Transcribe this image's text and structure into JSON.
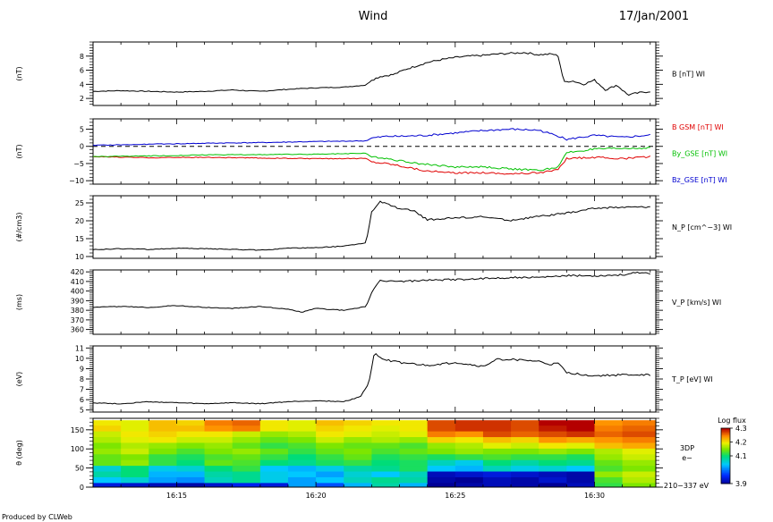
{
  "header": {
    "title": "Wind",
    "date": "17/Jan/2001"
  },
  "footer": {
    "credit": "Produced by CLWeb"
  },
  "x_axis": {
    "start_min": 12.0,
    "end_min": 32.2,
    "ticks": [
      {
        "value": 15,
        "label": "16:15"
      },
      {
        "value": 20,
        "label": "16:20"
      },
      {
        "value": 25,
        "label": "16:25"
      },
      {
        "value": 30,
        "label": "16:30"
      }
    ]
  },
  "chart_data": [
    {
      "type": "line",
      "ylabel": "(nT)",
      "ylim": [
        1,
        10
      ],
      "yticks": [
        "2",
        "4",
        "6",
        "8"
      ],
      "ytick_values": [
        2,
        4,
        6,
        8
      ],
      "series": [
        {
          "name": "B [nT] WI",
          "color": "#000000",
          "x": [
            12.0,
            13.0,
            14.0,
            15.0,
            16.0,
            17.0,
            18.0,
            19.0,
            20.0,
            21.0,
            21.8,
            22.0,
            22.3,
            22.8,
            23.2,
            23.6,
            24.0,
            24.5,
            25.0,
            25.5,
            26.0,
            26.5,
            27.0,
            27.5,
            28.0,
            28.5,
            28.7,
            28.9,
            29.2,
            29.6,
            30.0,
            30.4,
            30.8,
            31.2,
            31.6,
            32.0
          ],
          "y": [
            3.0,
            3.1,
            3.0,
            2.9,
            3.0,
            3.2,
            3.0,
            3.3,
            3.5,
            3.6,
            3.9,
            4.6,
            5.1,
            5.4,
            6.1,
            6.6,
            7.1,
            7.5,
            7.8,
            8.0,
            8.1,
            8.3,
            8.4,
            8.5,
            8.2,
            8.3,
            8.0,
            4.3,
            4.5,
            4.0,
            4.6,
            3.2,
            3.9,
            2.5,
            2.8,
            3.0
          ]
        }
      ]
    },
    {
      "type": "line",
      "ylabel": "(nT)",
      "ylim": [
        -11,
        8
      ],
      "yticks": [
        "−10",
        "−5",
        "0",
        "5"
      ],
      "ytick_values": [
        -10,
        -5,
        0,
        5
      ],
      "zero_line": true,
      "series": [
        {
          "name": "B GSM [nT] WI",
          "color": "#e00000",
          "x": [
            12.0,
            14.0,
            16.0,
            18.0,
            20.0,
            21.8,
            22.0,
            22.6,
            23.0,
            24.0,
            25.0,
            26.0,
            27.0,
            28.0,
            28.7,
            29.0,
            30.0,
            31.0,
            32.0
          ],
          "y": [
            -3.0,
            -3.3,
            -3.2,
            -3.4,
            -3.6,
            -3.5,
            -4.5,
            -5.0,
            -5.6,
            -7.2,
            -7.8,
            -7.6,
            -8.0,
            -7.7,
            -6.8,
            -3.5,
            -3.2,
            -3.6,
            -3.0
          ]
        },
        {
          "name": "By_GSE [nT] WI",
          "color": "#00c000",
          "x": [
            12.0,
            14.0,
            16.0,
            18.0,
            20.0,
            21.8,
            22.0,
            22.5,
            23.0,
            24.0,
            25.0,
            26.0,
            27.0,
            28.0,
            28.7,
            29.0,
            30.0,
            31.0,
            32.0
          ],
          "y": [
            -3.0,
            -2.8,
            -2.5,
            -2.4,
            -2.3,
            -2.0,
            -3.0,
            -3.5,
            -4.2,
            -5.3,
            -6.0,
            -6.0,
            -6.6,
            -7.0,
            -6.0,
            -1.8,
            -0.8,
            -0.6,
            -0.5
          ]
        },
        {
          "name": "Bz_GSE [nT] WI",
          "color": "#0000d0",
          "x": [
            12.0,
            14.0,
            16.0,
            18.0,
            20.0,
            21.8,
            22.0,
            22.5,
            23.0,
            24.0,
            25.0,
            26.0,
            27.0,
            28.0,
            28.7,
            29.0,
            30.0,
            31.0,
            32.0
          ],
          "y": [
            0.3,
            0.6,
            0.9,
            1.1,
            1.4,
            1.6,
            2.4,
            2.9,
            2.9,
            3.2,
            3.9,
            4.6,
            5.0,
            4.7,
            3.0,
            2.0,
            3.2,
            2.6,
            3.3
          ]
        }
      ]
    },
    {
      "type": "line",
      "ylabel": "(#/cm3)",
      "ylim": [
        9.5,
        27
      ],
      "yticks": [
        "10",
        "15",
        "20",
        "25"
      ],
      "ytick_values": [
        10,
        15,
        20,
        25
      ],
      "series": [
        {
          "name": "N_P [cm^−3] WI",
          "color": "#000000",
          "x": [
            12.0,
            13.0,
            14.0,
            15.0,
            16.0,
            17.0,
            18.0,
            19.0,
            20.0,
            21.0,
            21.8,
            22.0,
            22.3,
            23.0,
            23.5,
            24.0,
            25.0,
            26.0,
            27.0,
            28.0,
            29.0,
            30.0,
            31.0,
            32.0
          ],
          "y": [
            11.9,
            12.2,
            12.0,
            12.3,
            12.2,
            12.0,
            11.8,
            12.3,
            12.5,
            12.9,
            13.8,
            22.5,
            25.3,
            23.4,
            22.8,
            20.3,
            20.8,
            21.1,
            20.1,
            21.2,
            22.1,
            23.5,
            23.8,
            23.9
          ]
        }
      ]
    },
    {
      "type": "line",
      "ylabel": "(ms)",
      "ylim": [
        355,
        422
      ],
      "yticks": [
        "360",
        "370",
        "380",
        "390",
        "400",
        "410",
        "420"
      ],
      "ytick_values": [
        360,
        370,
        380,
        390,
        400,
        410,
        420
      ],
      "series": [
        {
          "name": "V_P [km/s] WI",
          "color": "#000000",
          "x": [
            12.0,
            13.0,
            14.0,
            15.0,
            16.0,
            17.0,
            18.0,
            19.0,
            19.5,
            20.0,
            21.0,
            21.8,
            22.0,
            22.3,
            23.0,
            24.0,
            25.0,
            26.0,
            27.0,
            28.0,
            29.0,
            30.0,
            31.0,
            31.5,
            32.0
          ],
          "y": [
            383.0,
            384.0,
            383.0,
            385.0,
            383.0,
            382.0,
            384.0,
            381.0,
            378.0,
            382.0,
            380.0,
            384.0,
            398.0,
            411.0,
            410.0,
            411.0,
            412.0,
            413.0,
            414.0,
            414.0,
            416.0,
            416.0,
            417.0,
            419.0,
            418.0
          ]
        }
      ]
    },
    {
      "type": "line",
      "ylabel": "(eV)",
      "ylim": [
        4.8,
        11.2
      ],
      "yticks": [
        "5",
        "6",
        "7",
        "8",
        "9",
        "10",
        "11"
      ],
      "ytick_values": [
        5,
        6,
        7,
        8,
        9,
        10,
        11
      ],
      "series": [
        {
          "name": "T_P [eV] WI",
          "color": "#000000",
          "x": [
            12.0,
            13.0,
            14.0,
            15.0,
            16.0,
            17.0,
            18.0,
            19.0,
            20.0,
            21.0,
            21.6,
            21.9,
            22.1,
            22.4,
            23.0,
            24.0,
            25.0,
            26.0,
            26.5,
            27.0,
            28.0,
            28.4,
            28.7,
            29.0,
            30.0,
            31.0,
            32.0
          ],
          "y": [
            5.7,
            5.6,
            5.8,
            5.7,
            5.6,
            5.7,
            5.6,
            5.8,
            5.9,
            5.8,
            6.3,
            7.6,
            10.6,
            9.9,
            9.6,
            9.3,
            9.6,
            9.2,
            9.9,
            9.9,
            9.7,
            9.4,
            9.5,
            8.6,
            8.3,
            8.4,
            8.4
          ]
        }
      ]
    },
    {
      "type": "heatmap",
      "ylabel": "θ (deg)",
      "ylim": [
        0,
        180
      ],
      "yticks": [
        "0",
        "50",
        "100",
        "150"
      ],
      "ytick_values": [
        0,
        50,
        100,
        150
      ],
      "label_lines": [
        "3DP",
        "e−",
        "210−337 eV"
      ],
      "colorbar": {
        "title": "Log flux",
        "range": [
          3.9,
          4.3
        ],
        "ticks": [
          "4.3",
          "4.2",
          "4.1",
          "3.9"
        ],
        "tick_values": [
          4.3,
          4.2,
          4.1,
          3.9
        ]
      },
      "x_edges": [
        12.0,
        13.0,
        14.0,
        15.0,
        16.0,
        17.0,
        18.0,
        19.0,
        20.0,
        21.0,
        22.0,
        23.0,
        24.0,
        25.0,
        26.0,
        27.0,
        28.0,
        29.0,
        30.0,
        31.0,
        32.2
      ],
      "y_edges": [
        0,
        12,
        27,
        42,
        57,
        72,
        87,
        102,
        117,
        132,
        147,
        162,
        175
      ],
      "values": [
        [
          3.94,
          3.93,
          3.92,
          3.91,
          3.93,
          3.95,
          3.94,
          4.02,
          3.98,
          4.03,
          4.08,
          4.03,
          3.9,
          3.91,
          3.92,
          3.91,
          3.9,
          3.92,
          4.12,
          4.15
        ],
        [
          4.04,
          4.06,
          4.02,
          4.01,
          4.07,
          4.09,
          4.05,
          4.02,
          4.04,
          4.07,
          4.09,
          4.08,
          3.91,
          3.9,
          3.92,
          3.91,
          3.93,
          3.91,
          4.13,
          4.17
        ],
        [
          4.08,
          4.1,
          4.03,
          4.03,
          4.08,
          4.09,
          4.05,
          4.04,
          4.02,
          4.06,
          4.04,
          4.07,
          3.92,
          3.93,
          3.94,
          3.93,
          3.92,
          3.91,
          4.16,
          4.18
        ],
        [
          4.06,
          4.1,
          4.05,
          4.06,
          4.1,
          4.12,
          4.04,
          4.03,
          4.05,
          4.08,
          4.09,
          4.11,
          4.04,
          4.03,
          4.07,
          4.05,
          4.06,
          4.04,
          4.13,
          4.15
        ],
        [
          4.14,
          4.16,
          4.12,
          4.1,
          4.14,
          4.13,
          4.1,
          4.09,
          4.11,
          4.12,
          4.1,
          4.11,
          4.07,
          4.05,
          4.1,
          4.08,
          4.1,
          4.09,
          4.14,
          4.16
        ],
        [
          4.14,
          4.15,
          4.12,
          4.11,
          4.13,
          4.14,
          4.12,
          4.1,
          4.12,
          4.14,
          4.11,
          4.12,
          4.11,
          4.12,
          4.13,
          4.12,
          4.12,
          4.11,
          4.16,
          4.18
        ],
        [
          4.16,
          4.18,
          4.15,
          4.13,
          4.15,
          4.16,
          4.14,
          4.12,
          4.14,
          4.15,
          4.13,
          4.14,
          4.15,
          4.16,
          4.15,
          4.15,
          4.16,
          4.15,
          4.17,
          4.19
        ],
        [
          4.15,
          4.17,
          4.16,
          4.15,
          4.16,
          4.14,
          4.12,
          4.13,
          4.15,
          4.14,
          4.14,
          4.13,
          4.16,
          4.17,
          4.19,
          4.18,
          4.2,
          4.19,
          4.22,
          4.23
        ],
        [
          4.17,
          4.19,
          4.2,
          4.18,
          4.18,
          4.16,
          4.14,
          4.15,
          4.18,
          4.16,
          4.17,
          4.16,
          4.21,
          4.2,
          4.22,
          4.21,
          4.24,
          4.23,
          4.24,
          4.25
        ],
        [
          4.18,
          4.2,
          4.21,
          4.2,
          4.2,
          4.18,
          4.16,
          4.17,
          4.2,
          4.19,
          4.18,
          4.19,
          4.25,
          4.24,
          4.27,
          4.26,
          4.27,
          4.28,
          4.26,
          4.27
        ],
        [
          4.21,
          4.19,
          4.22,
          4.22,
          4.24,
          4.25,
          4.2,
          4.19,
          4.21,
          4.2,
          4.19,
          4.2,
          4.27,
          4.28,
          4.28,
          4.27,
          4.29,
          4.3,
          4.25,
          4.26
        ],
        [
          4.2,
          4.19,
          4.22,
          4.21,
          4.25,
          4.26,
          4.2,
          4.19,
          4.22,
          4.21,
          4.2,
          4.2,
          4.27,
          4.28,
          4.28,
          4.27,
          4.3,
          4.31,
          4.24,
          4.25
        ]
      ]
    }
  ]
}
